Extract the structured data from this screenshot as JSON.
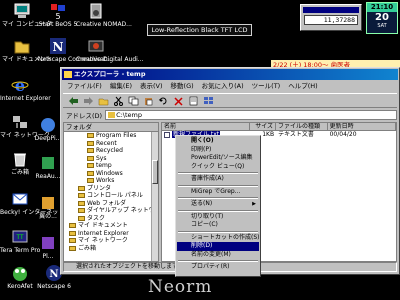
{
  "desktop_icons": [
    {
      "label": "マイ コンピュータ",
      "icon": "my-computer-icon"
    },
    {
      "label": "Start BeOS 5",
      "icon": "beos-icon"
    },
    {
      "label": "Creative NOMAD...",
      "icon": "nomad-icon"
    },
    {
      "label": "マイ ドキュメント",
      "icon": "my-documents-icon"
    },
    {
      "label": "Netscape Communicat...",
      "icon": "netscape-icon"
    },
    {
      "label": "Creative Digital Audi...",
      "icon": "creative-audio-icon"
    },
    {
      "label": "Internet Explorer",
      "icon": "internet-explorer-icon"
    },
    {
      "label": "マイ ネットワーク",
      "icon": "network-icon"
    },
    {
      "label": "DeepPi...",
      "icon": "deeppi-icon"
    },
    {
      "label": "ごみ箱",
      "icon": "recycle-bin-icon"
    },
    {
      "label": "ReaAu...",
      "icon": "reaau-icon"
    },
    {
      "label": "Becky! インターネット...",
      "icon": "becky-icon"
    },
    {
      "label": "翼の...",
      "icon": "wing-icon"
    },
    {
      "label": "Tera Term Pro",
      "icon": "teraterm-icon"
    },
    {
      "label": "Pl...",
      "icon": "pl-icon"
    },
    {
      "label": "KeroAfet",
      "icon": "kero-icon"
    },
    {
      "label": "Netscape 6",
      "icon": "netscape6-icon"
    }
  ],
  "lcd_banner": "Low-Reflection Black TFT LCD",
  "meter": {
    "value": "11,37288"
  },
  "clock": {
    "time": "21:10",
    "day": "20",
    "weekday": "SAT"
  },
  "reminder": "2/22 (土) 18:00～ 歯医者",
  "explorer": {
    "title": "エクスプローラ - temp",
    "menus": [
      "ファイル(F)",
      "編集(E)",
      "表示(V)",
      "移動(G)",
      "お気に入り(A)",
      "ツール(T)",
      "ヘルプ(H)"
    ],
    "address_label": "アドレス(D)",
    "address_value": "C:\\temp",
    "folder_header": "フォルダ",
    "tree": [
      {
        "label": "Program Files",
        "indent": 3
      },
      {
        "label": "Recent",
        "indent": 3
      },
      {
        "label": "Recycled",
        "indent": 3
      },
      {
        "label": "Sys",
        "indent": 3
      },
      {
        "label": "temp",
        "indent": 3
      },
      {
        "label": "Windows",
        "indent": 3
      },
      {
        "label": "Works",
        "indent": 3
      },
      {
        "label": "プリンタ",
        "indent": 2
      },
      {
        "label": "コントロール パネル",
        "indent": 2
      },
      {
        "label": "Web フォルダ",
        "indent": 2
      },
      {
        "label": "ダイヤルアップ ネットワーク",
        "indent": 2
      },
      {
        "label": "タスク",
        "indent": 2
      },
      {
        "label": "マイ ドキュメント",
        "indent": 1
      },
      {
        "label": "Internet Explorer",
        "indent": 1
      },
      {
        "label": "マイ ネットワーク",
        "indent": 1
      },
      {
        "label": "ごみ箱",
        "indent": 1
      }
    ],
    "columns": [
      "名前",
      "サイズ",
      "ファイルの種類",
      "更新日時"
    ],
    "file": {
      "name": "新規ファイル.txt",
      "size": "1KB",
      "type": "テキスト文書",
      "date": "00/04/20"
    },
    "status": "選択されたオブジェクトを移動します。"
  },
  "context_menu": [
    {
      "label": "開く(O)",
      "bold": true
    },
    {
      "label": "印刷(P)"
    },
    {
      "label": "PowerEdit/ソース編集"
    },
    {
      "label": "クイック ビュー(Q)"
    },
    {
      "sep": true
    },
    {
      "label": "書庫作成(A)"
    },
    {
      "sep": true
    },
    {
      "label": "MiGrep でGrep..."
    },
    {
      "sep": true
    },
    {
      "label": "送る(N)",
      "submenu": true
    },
    {
      "sep": true
    },
    {
      "label": "切り取り(T)"
    },
    {
      "label": "コピー(C)"
    },
    {
      "sep": true
    },
    {
      "label": "ショートカットの作成(S)"
    },
    {
      "label": "削除(D)",
      "highlight": true
    },
    {
      "label": "名前の変更(M)"
    },
    {
      "sep": true
    },
    {
      "label": "プロパティ(R)"
    }
  ],
  "wallpaper_text": "Neorm"
}
